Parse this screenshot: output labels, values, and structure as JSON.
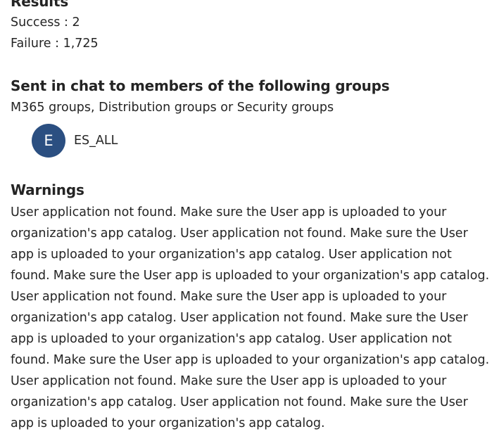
{
  "results": {
    "heading": "Results",
    "success": "Success : 2",
    "failure": "Failure : 1,725"
  },
  "groups": {
    "heading": "Sent in chat to members of the following groups",
    "subtitle": "M365 groups, Distribution groups or Security groups",
    "items": [
      {
        "initial": "E",
        "name": "ES_ALL",
        "avatar_color": "#2b4f81"
      }
    ]
  },
  "warnings": {
    "heading": "Warnings",
    "text": "User application not found. Make sure the User app is uploaded to your organization's app catalog. User application not found. Make sure the User app is uploaded to your organization's app catalog. User application not found. Make sure the User app is uploaded to your organization's app catalog. User application not found. Make sure the User app is uploaded to your organization's app catalog. User application not found. Make sure the User app is uploaded to your organization's app catalog. User application not found. Make sure the User app is uploaded to your organization's app catalog. User application not found. Make sure the User app is uploaded to your organization's app catalog. User application not found. Make sure the User app is uploaded to your organization's app catalog."
  }
}
